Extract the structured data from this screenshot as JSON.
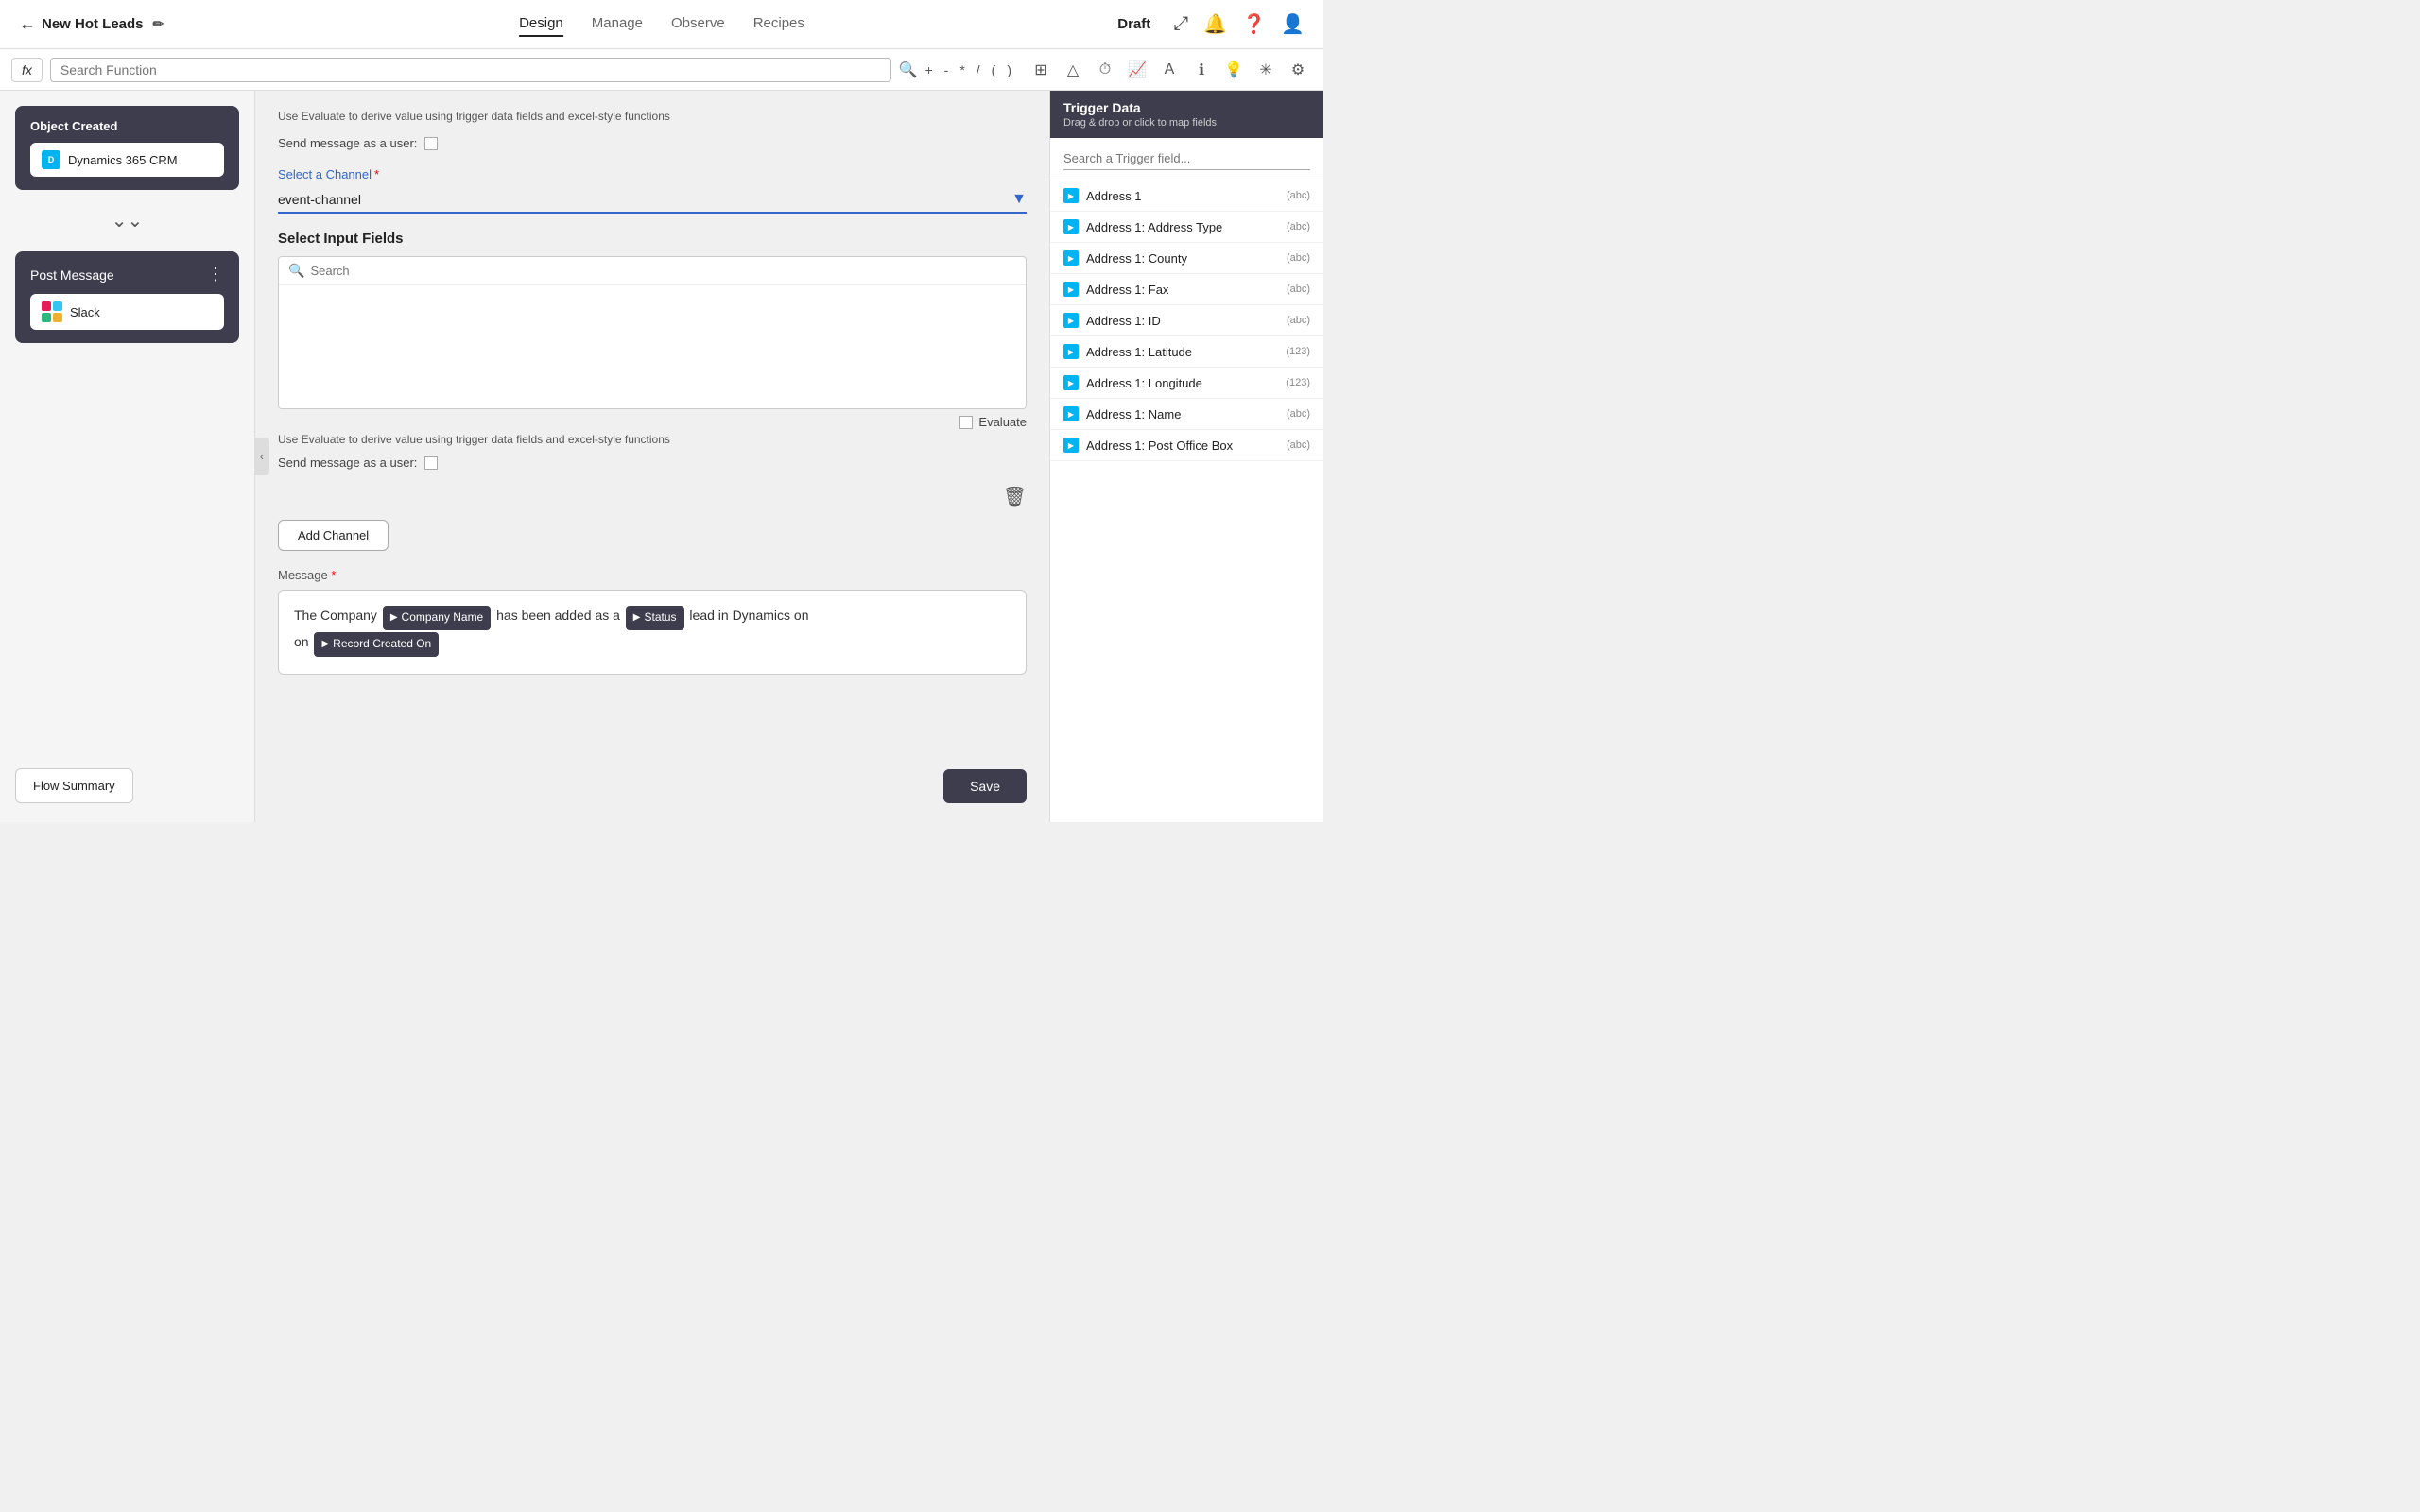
{
  "app": {
    "title": "New Hot Leads",
    "status": "Draft"
  },
  "nav": {
    "back_label": "New Hot Leads",
    "tabs": [
      "Design",
      "Manage",
      "Observe",
      "Recipes"
    ],
    "active_tab": "Design"
  },
  "formula_bar": {
    "fx_label": "fx",
    "search_placeholder": "Search Function",
    "operators": [
      "+",
      "-",
      "*",
      "/",
      "(",
      ")"
    ]
  },
  "sidebar": {
    "object_created_title": "Object Created",
    "dynamics_label": "Dynamics 365 CRM",
    "post_message_title": "Post Message",
    "slack_label": "Slack",
    "flow_summary_label": "Flow Summary"
  },
  "main": {
    "evaluate_hint": "Use Evaluate to derive value using trigger data fields and excel-style functions",
    "send_message_label": "Send message as a user:",
    "channel_label": "Select a Channel",
    "channel_value": "event-channel",
    "select_input_fields_label": "Select Input Fields",
    "search_placeholder": "Search",
    "evaluate_label": "Evaluate",
    "hint_text_2": "Use Evaluate to derive value using trigger data fields and excel-style functions",
    "send_message_label_2": "Send message as a user:",
    "add_channel_label": "Add Channel",
    "message_label": "Message",
    "message_required": "*",
    "message_text_before": "The Company",
    "message_token_1": "Company Name",
    "message_text_middle": "has been added as a",
    "message_token_2": "Status",
    "message_text_end": "lead in Dynamics on",
    "message_token_3": "Record Created On",
    "save_label": "Save"
  },
  "right_panel": {
    "title": "Trigger Data",
    "subtitle": "Drag & drop or click to map fields",
    "search_placeholder": "Search a Trigger field...",
    "fields": [
      {
        "name": "Address 1",
        "type": "abc"
      },
      {
        "name": "Address 1: Address Type",
        "type": "abc"
      },
      {
        "name": "Address 1: County",
        "type": "abc"
      },
      {
        "name": "Address 1: Fax",
        "type": "abc"
      },
      {
        "name": "Address 1: ID",
        "type": "abc"
      },
      {
        "name": "Address 1: Latitude",
        "type": "123"
      },
      {
        "name": "Address 1: Longitude",
        "type": "123"
      },
      {
        "name": "Address 1: Name",
        "type": "abc"
      },
      {
        "name": "Address 1: Post Office Box",
        "type": "abc"
      }
    ]
  }
}
